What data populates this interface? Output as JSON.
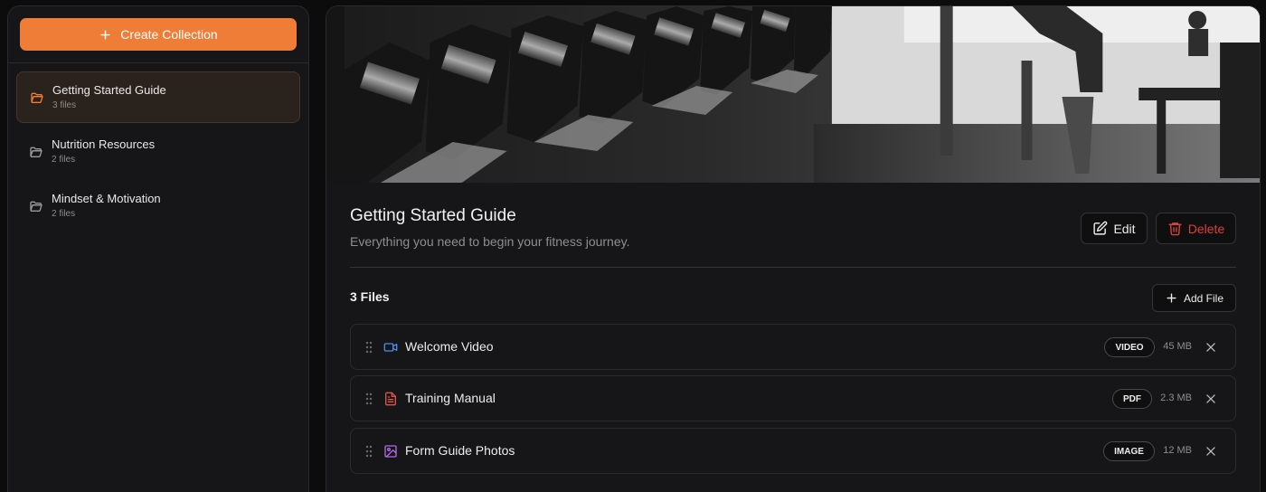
{
  "sidebar": {
    "create_label": "Create Collection",
    "collections": [
      {
        "name": "Getting Started Guide",
        "count": "3 files",
        "active": true
      },
      {
        "name": "Nutrition Resources",
        "count": "2 files",
        "active": false
      },
      {
        "name": "Mindset & Motivation",
        "count": "2 files",
        "active": false
      }
    ]
  },
  "main": {
    "title": "Getting Started Guide",
    "description": "Everything you need to begin your fitness journey.",
    "edit_label": "Edit",
    "delete_label": "Delete",
    "files_count": "3 Files",
    "add_file_label": "Add File",
    "files": [
      {
        "name": "Welcome Video",
        "type": "VIDEO",
        "size": "45 MB",
        "icon": "video-icon",
        "icon_color": "#4f8cf0"
      },
      {
        "name": "Training Manual",
        "type": "PDF",
        "size": "2.3 MB",
        "icon": "document-icon",
        "icon_color": "#e0524d"
      },
      {
        "name": "Form Guide Photos",
        "type": "IMAGE",
        "size": "12 MB",
        "icon": "image-icon",
        "icon_color": "#b36be6"
      }
    ]
  },
  "colors": {
    "accent": "#ef7d37",
    "danger": "#d8403b",
    "background": "#0c0c0d",
    "panel": "#161618"
  }
}
